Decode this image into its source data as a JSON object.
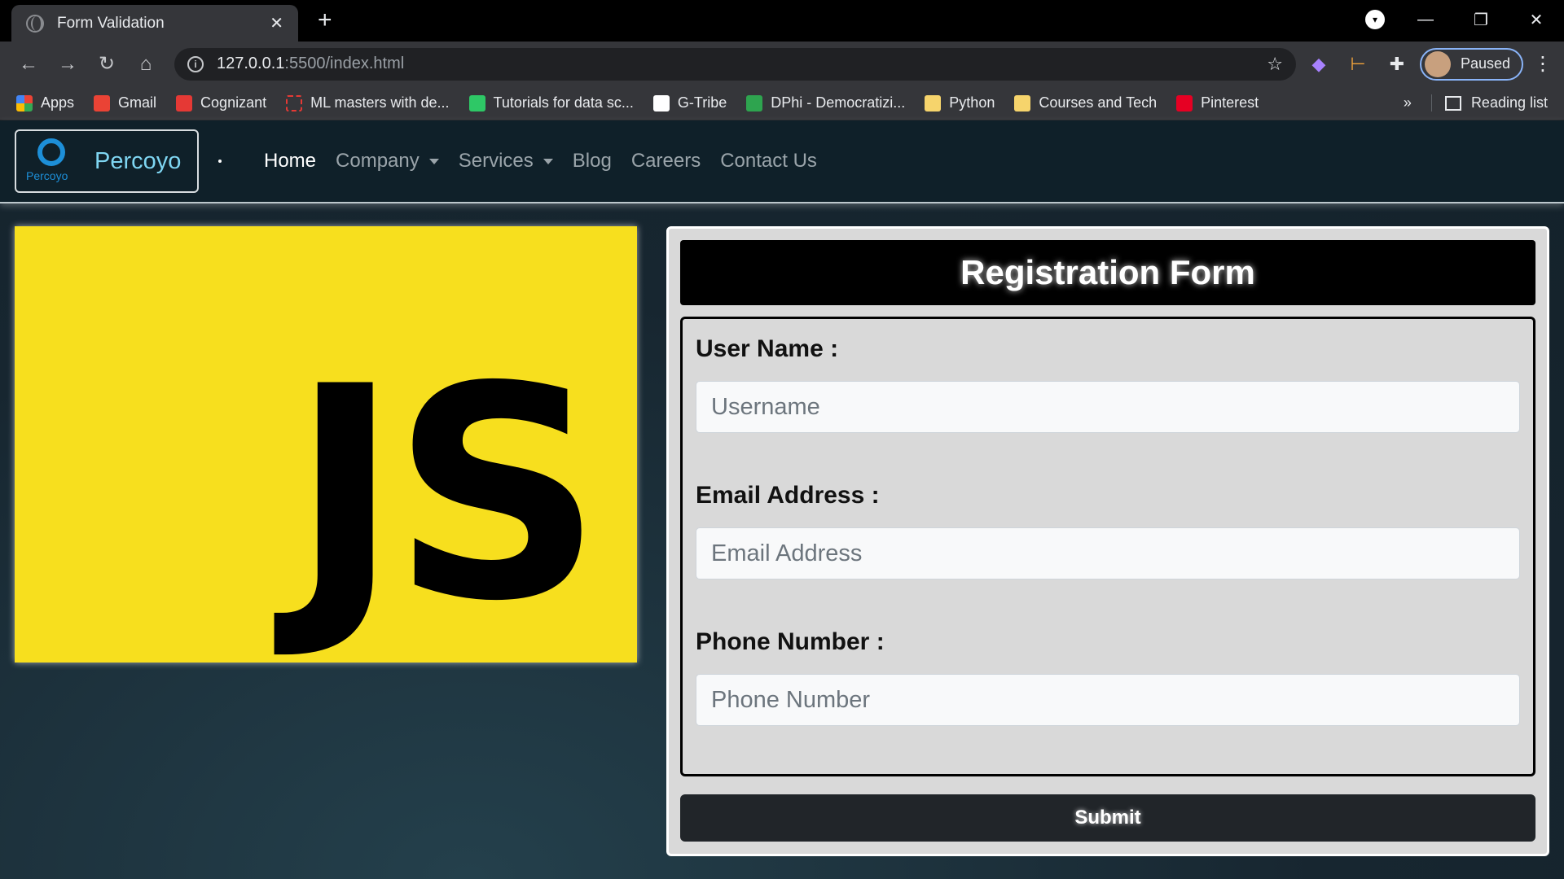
{
  "browser": {
    "tab_title": "Form Validation",
    "tab_close": "✕",
    "new_tab": "+",
    "url_host": "127.0.0.1",
    "url_path": ":5500/index.html",
    "profile_status": "Paused",
    "window_controls": [
      "—",
      "❐",
      "✕"
    ],
    "bookmarks": [
      {
        "label": "Apps",
        "icon": "apps-icon"
      },
      {
        "label": "Gmail",
        "icon": "gmail-icon"
      },
      {
        "label": "Cognizant",
        "icon": "cognizant-icon"
      },
      {
        "label": "ML masters with de...",
        "icon": "ml-icon"
      },
      {
        "label": "Tutorials for data sc...",
        "icon": "tutorials-icon"
      },
      {
        "label": "G-Tribe",
        "icon": "gtribe-icon"
      },
      {
        "label": "DPhi - Democratizi...",
        "icon": "dphi-icon"
      },
      {
        "label": "Python",
        "icon": "folder-icon"
      },
      {
        "label": "Courses and Tech",
        "icon": "folder-icon"
      },
      {
        "label": "Pinterest",
        "icon": "pinterest-icon"
      }
    ],
    "bookmarks_overflow": "»",
    "reading_list": "Reading list"
  },
  "navbar": {
    "brand_logo_text": "Percoyo",
    "brand_name": "Percoyo",
    "links": [
      {
        "label": "Home",
        "active": true,
        "dropdown": false
      },
      {
        "label": "Company",
        "active": false,
        "dropdown": true
      },
      {
        "label": "Services",
        "active": false,
        "dropdown": true
      },
      {
        "label": "Blog",
        "active": false,
        "dropdown": false
      },
      {
        "label": "Careers",
        "active": false,
        "dropdown": false
      },
      {
        "label": "Contact Us",
        "active": false,
        "dropdown": false
      }
    ]
  },
  "hero": {
    "logo_text": "JS",
    "logo_bg": "#f7df1e"
  },
  "form": {
    "title": "Registration Form",
    "fields": [
      {
        "label": "User Name :",
        "placeholder": "Username"
      },
      {
        "label": "Email Address :",
        "placeholder": "Email Address"
      },
      {
        "label": "Phone Number :",
        "placeholder": "Phone Number"
      }
    ],
    "submit_label": "Submit"
  }
}
